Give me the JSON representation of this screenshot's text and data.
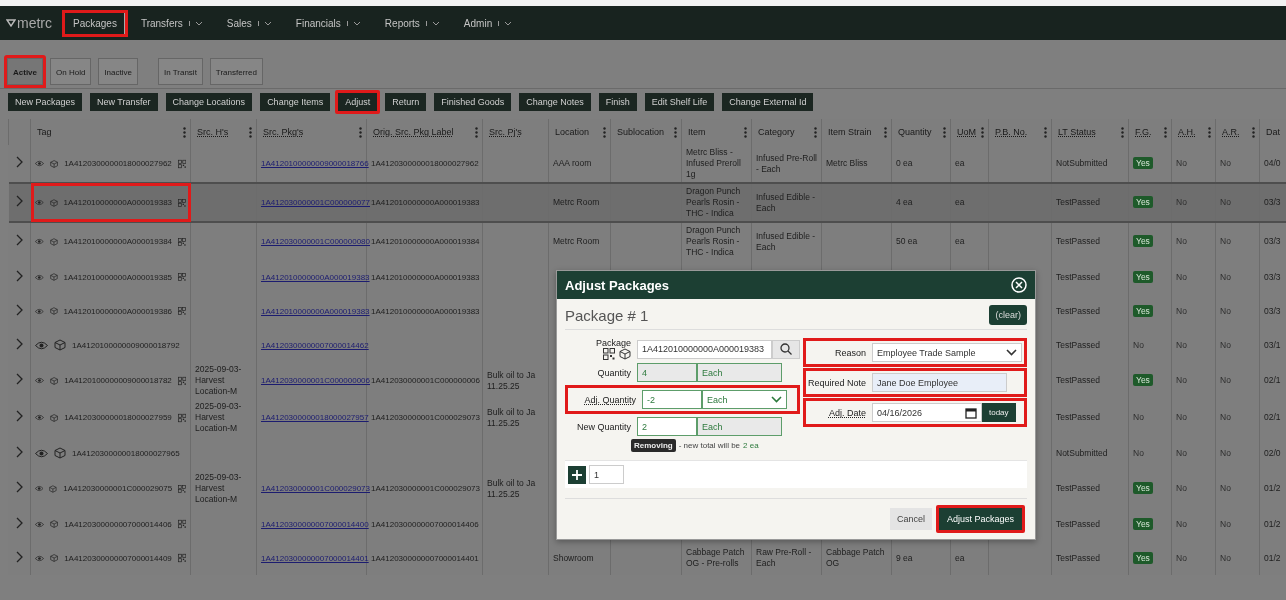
{
  "nav": {
    "logo": "metrc",
    "items": [
      {
        "label": "Packages",
        "dropdown": false,
        "highlighted": true
      },
      {
        "label": "Transfers",
        "dropdown": true,
        "highlighted": false
      },
      {
        "label": "Sales",
        "dropdown": true,
        "highlighted": false
      },
      {
        "label": "Financials",
        "dropdown": true,
        "highlighted": false
      },
      {
        "label": "Reports",
        "dropdown": true,
        "highlighted": false
      },
      {
        "label": "Admin",
        "dropdown": true,
        "highlighted": false
      }
    ]
  },
  "tab_groups": [
    [
      {
        "label": "Active",
        "selected": true,
        "highlighted": true
      },
      {
        "label": "On Hold",
        "selected": false,
        "highlighted": false
      },
      {
        "label": "Inactive",
        "selected": false,
        "highlighted": false
      }
    ],
    [
      {
        "label": "In Transit",
        "selected": false,
        "highlighted": false
      },
      {
        "label": "Transferred",
        "selected": false,
        "highlighted": false
      }
    ]
  ],
  "toolbar": [
    {
      "label": "New Packages",
      "highlighted": false
    },
    {
      "label": "New Transfer",
      "highlighted": false
    },
    {
      "label": "Change Locations",
      "highlighted": false
    },
    {
      "label": "Change Items",
      "highlighted": false
    },
    {
      "label": "Adjust",
      "highlighted": true
    },
    {
      "label": "Return",
      "highlighted": false
    },
    {
      "label": "Finished Goods",
      "highlighted": false
    },
    {
      "label": "Change Notes",
      "highlighted": false
    },
    {
      "label": "Finish",
      "highlighted": false
    },
    {
      "label": "Edit Shelf Life",
      "highlighted": false
    },
    {
      "label": "Change External Id",
      "highlighted": false
    }
  ],
  "table": {
    "columns": [
      {
        "label": "Tag",
        "abbr": false,
        "menu": true
      },
      {
        "label": "Src. H's",
        "abbr": true,
        "menu": true
      },
      {
        "label": "Src. Pkg's",
        "abbr": true,
        "menu": true
      },
      {
        "label": "Orig. Src. Pkg Label",
        "abbr": true,
        "menu": true
      },
      {
        "label": "Src. Pj's",
        "abbr": true,
        "menu": false
      },
      {
        "label": "Location",
        "abbr": false,
        "menu": true
      },
      {
        "label": "Sublocation",
        "abbr": false,
        "menu": true
      },
      {
        "label": "Item",
        "abbr": false,
        "menu": true
      },
      {
        "label": "Category",
        "abbr": false,
        "menu": true
      },
      {
        "label": "Item Strain",
        "abbr": false,
        "menu": true
      },
      {
        "label": "Quantity",
        "abbr": false,
        "menu": true
      },
      {
        "label": "UoM",
        "abbr": true,
        "menu": true
      },
      {
        "label": "P.B. No.",
        "abbr": true,
        "menu": true
      },
      {
        "label": "LT Status",
        "abbr": true,
        "menu": true
      },
      {
        "label": "F.G.",
        "abbr": true,
        "menu": true
      },
      {
        "label": "A.H.",
        "abbr": true,
        "menu": true
      },
      {
        "label": "A.R.",
        "abbr": true,
        "menu": true
      },
      {
        "label": "Dat",
        "abbr": false,
        "menu": false
      }
    ],
    "rows": [
      {
        "selected": false,
        "tag_highlighted": false,
        "qr": true,
        "tag": "1A4120300000018000027962",
        "src_packages": "1A4120100000009000018766",
        "orig_label": "1A4120300000018000027962",
        "location": "AAA room",
        "item": "Metrc Bliss - Infused Preroll 1g",
        "category": "Infused Pre-Roll - Each",
        "strain": "Metrc Bliss",
        "quantity": "0 ea",
        "uom": "ea",
        "lt_status": "NotSubmitted",
        "fg": {
          "text": "Yes",
          "on": true
        },
        "ah": {
          "text": "No",
          "on": false
        },
        "ar": {
          "text": "No",
          "on": false
        },
        "date": "04/0"
      },
      {
        "selected": true,
        "tag_highlighted": true,
        "qr": true,
        "tag": "1A412010000000A000019383",
        "src_packages": "1A412030000001C000000077",
        "orig_label": "1A412010000000A000019383",
        "location": "Metrc Room",
        "item": "Dragon Punch Pearls Rosin - THC - Indica",
        "category": "Infused Edible - Each",
        "quantity": "4 ea",
        "uom": "ea",
        "lt_status": "TestPassed",
        "fg": {
          "text": "Yes",
          "on": true
        },
        "ah": {
          "text": "No",
          "on": false
        },
        "ar": {
          "text": "No",
          "on": false
        },
        "date": "03/3"
      },
      {
        "selected": false,
        "tag_highlighted": false,
        "qr": true,
        "tag": "1A412010000000A000019384",
        "src_packages": "1A412030000001C000000080",
        "orig_label": "1A412010000000A000019384",
        "location": "Metrc Room",
        "item": "Dragon Punch Pearls Rosin - THC - Indica",
        "category": "Infused Edible - Each",
        "quantity": "50 ea",
        "uom": "ea",
        "lt_status": "TestPassed",
        "fg": {
          "text": "Yes",
          "on": true
        },
        "ah": {
          "text": "No",
          "on": false
        },
        "ar": {
          "text": "No",
          "on": false
        },
        "date": "03/3"
      },
      {
        "selected": false,
        "tag_highlighted": false,
        "qr": true,
        "tag": "1A412010000000A000019385",
        "src_packages": "1A412010000000A000019383",
        "orig_label": "1A412010000000A000019383",
        "lt_status": "TestPassed",
        "fg": {
          "text": "Yes",
          "on": true
        },
        "ah": {
          "text": "No",
          "on": false
        },
        "ar": {
          "text": "No",
          "on": false
        },
        "date": "03/3"
      },
      {
        "selected": false,
        "tag_highlighted": false,
        "qr": true,
        "tag": "1A412010000000A000019386",
        "src_packages": "1A412010000000A000019383",
        "orig_label": "1A412010000000A000019383",
        "lt_status": "TestPassed",
        "fg": {
          "text": "Yes",
          "on": true
        },
        "ah": {
          "text": "No",
          "on": false
        },
        "ar": {
          "text": "No",
          "on": false
        },
        "date": "03/3"
      },
      {
        "selected": false,
        "tag_highlighted": false,
        "qr": false,
        "tag": "1A4120100000009000018792",
        "src_packages": "1A4120300000007000014462",
        "lt_status": "TestPassed",
        "fg": {
          "text": "No",
          "on": false
        },
        "ah": {
          "text": "No",
          "on": false
        },
        "ar": {
          "text": "No",
          "on": false
        },
        "date": "03/1"
      },
      {
        "selected": false,
        "tag_highlighted": false,
        "qr": true,
        "tag": "1A4120100000009000018782",
        "src_harvests": "2025-09-03-Harvest Location-M",
        "src_packages": "1A412030000001C000000006",
        "orig_label": "1A412030000001C000000006",
        "src_projects": "Bulk oil to Ja 11.25.25",
        "lt_status": "TestPassed",
        "fg": {
          "text": "Yes",
          "on": true
        },
        "ah": {
          "text": "No",
          "on": false
        },
        "ar": {
          "text": "No",
          "on": false
        },
        "date": "02/1"
      },
      {
        "selected": false,
        "tag_highlighted": false,
        "qr": true,
        "tag": "1A4120300000018000027959",
        "src_harvests": "2025-09-03-Harvest Location-M",
        "src_packages": "1A4120300000018000027957",
        "orig_label": "1A412030000001C000029073",
        "src_projects": "Bulk oil to Ja 11.25.25",
        "lt_status": "TestPassed",
        "fg": {
          "text": "No",
          "on": false
        },
        "ah": {
          "text": "No",
          "on": false
        },
        "ar": {
          "text": "No",
          "on": false
        },
        "date": "02/1"
      },
      {
        "selected": false,
        "tag_highlighted": false,
        "qr": false,
        "tag": "1A4120300000018000027965",
        "lt_status": "NotSubmitted",
        "fg": {
          "text": "No",
          "on": false
        },
        "ah": {
          "text": "No",
          "on": false
        },
        "ar": {
          "text": "No",
          "on": false
        },
        "date": "02/0"
      },
      {
        "selected": false,
        "tag_highlighted": false,
        "qr": true,
        "tag": "1A412030000001C000029075",
        "src_harvests": "2025-09-03-Harvest Location-M",
        "src_packages": "1A412030000001C000029073",
        "orig_label": "1A412030000001C000029073",
        "src_projects": "Bulk oil to Ja 11.25.25",
        "lt_status": "TestPassed",
        "fg": {
          "text": "Yes",
          "on": true
        },
        "ah": {
          "text": "No",
          "on": false
        },
        "ar": {
          "text": "No",
          "on": false
        },
        "date": "01/2"
      },
      {
        "selected": false,
        "tag_highlighted": false,
        "qr": true,
        "tag": "1A4120300000007000014406",
        "src_packages": "1A4120300000007000014400",
        "orig_label": "1A4120300000007000014406",
        "lt_status": "TestPassed",
        "fg": {
          "text": "Yes",
          "on": true
        },
        "ah": {
          "text": "No",
          "on": false
        },
        "ar": {
          "text": "No",
          "on": false
        },
        "date": "01/2"
      },
      {
        "selected": false,
        "tag_highlighted": false,
        "qr": true,
        "tag": "1A4120300000007000014409",
        "src_packages": "1A4120300000007000014401",
        "orig_label": "1A4120300000007000014401",
        "location": "Showroom",
        "item": "Cabbage Patch OG - Pre-rolls",
        "category": "Raw Pre-Roll - Each",
        "strain": "Cabbage Patch OG",
        "quantity": "9 ea",
        "uom": "ea",
        "lt_status": "TestPassed",
        "fg": {
          "text": "Yes",
          "on": true
        },
        "ah": {
          "text": "No",
          "on": false
        },
        "ar": {
          "text": "No",
          "on": false
        },
        "date": "01/2"
      }
    ]
  },
  "dialog": {
    "title": "Adjust Packages",
    "heading": "Package # 1",
    "clear": "(clear)",
    "package": {
      "label": "Package",
      "value": "1A412010000000A000019383"
    },
    "quantity": {
      "label": "Quantity",
      "value": "4",
      "unit": "Each"
    },
    "adj_quantity": {
      "label": "Adj. Quantity",
      "value": "-2",
      "unit": "Each",
      "highlighted": true
    },
    "new_quantity": {
      "label": "New Quantity",
      "value": "2",
      "unit": "Each"
    },
    "summary": {
      "badge": "Removing",
      "text": "- new total will be",
      "total": "2 ea"
    },
    "reason": {
      "label": "Reason",
      "value": "Employee Trade Sample",
      "highlighted": true
    },
    "note": {
      "label": "Required Note",
      "value": "Jane Doe Employee",
      "highlighted": true
    },
    "date": {
      "label": "Adj. Date",
      "value": "04/16/2026",
      "today": "today",
      "highlighted": true
    },
    "count": "1",
    "cancel": "Cancel",
    "submit": {
      "label": "Adjust Packages",
      "highlighted": true
    }
  }
}
